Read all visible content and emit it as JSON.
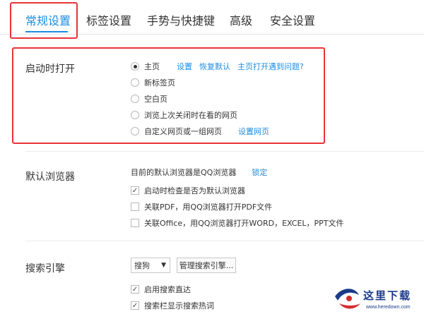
{
  "tabs": [
    {
      "label": "常规设置"
    },
    {
      "label": "标签设置"
    },
    {
      "label": "手势与快捷键"
    },
    {
      "label": "高级"
    },
    {
      "label": "安全设置"
    }
  ],
  "startup": {
    "title": "启动时打开",
    "options": [
      {
        "label": "主页",
        "checked": true
      },
      {
        "label": "新标签页"
      },
      {
        "label": "空白页"
      },
      {
        "label": "浏览上次关闭时在看的网页"
      },
      {
        "label": "自定义网页或一组网页"
      }
    ],
    "links": {
      "settings": "设置",
      "restore": "恢复默认",
      "problem": "主页打开遇到问题?",
      "set_pages": "设置网页"
    }
  },
  "default_browser": {
    "title": "默认浏览器",
    "status": "目前的默认浏览器是QQ浏览器",
    "lock": "锁定",
    "checks": [
      {
        "label": "启动时检查是否为默认浏览器",
        "checked": true
      },
      {
        "label": "关联PDF，用QQ浏览器打开PDF文件",
        "checked": false
      },
      {
        "label": "关联Office，用QQ浏览器打开WORD，EXCEL，PPT文件",
        "checked": false
      }
    ]
  },
  "search": {
    "title": "搜索引擎",
    "engine": "搜狗",
    "manage_button": "管理搜索引擎...",
    "checks": [
      {
        "label": "启用搜索直达",
        "checked": true
      },
      {
        "label": "搜索栏显示搜索热词",
        "checked": true
      }
    ]
  },
  "watermark": {
    "brand": "这里下载",
    "url": "www.heredown.com"
  },
  "colors": {
    "accent": "#1e8ce0",
    "highlight": "#e8343a"
  }
}
